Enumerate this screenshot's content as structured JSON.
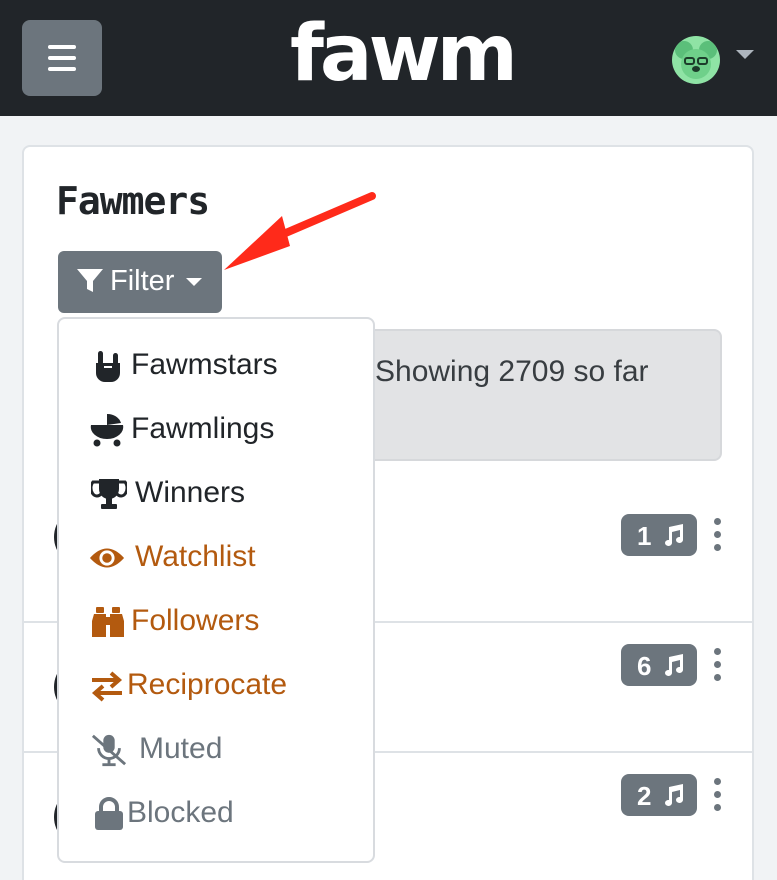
{
  "brand": {
    "logo_text": "fawm"
  },
  "page": {
    "title": "Fawmers"
  },
  "filter": {
    "label": "Filter"
  },
  "alert": {
    "text": "Showing 2709 so far"
  },
  "dropdown": {
    "items": [
      {
        "label": "Fawmstars",
        "icon": "rock-hand-icon",
        "color": "#212529"
      },
      {
        "label": "Fawmlings",
        "icon": "baby-carriage-icon",
        "color": "#212529"
      },
      {
        "label": "Winners",
        "icon": "trophy-icon",
        "color": "#212529"
      },
      {
        "label": "Watchlist",
        "icon": "eye-icon",
        "color": "#b35a0f"
      },
      {
        "label": "Followers",
        "icon": "binoculars-icon",
        "color": "#b35a0f"
      },
      {
        "label": "Reciprocate",
        "icon": "exchange-arrows-icon",
        "color": "#b35a0f"
      },
      {
        "label": "Muted",
        "icon": "muted-microphone-icon",
        "color": "#6c757d"
      },
      {
        "label": "Blocked",
        "icon": "lock-icon",
        "color": "#6c757d"
      }
    ]
  },
  "rows": [
    {
      "song_count": "1"
    },
    {
      "song_count": "6"
    },
    {
      "song_count": "2"
    }
  ],
  "colors": {
    "navbar": "#212529",
    "button": "#6c757d",
    "accent": "#b35a0f",
    "annotation_arrow": "#ff2a1a"
  }
}
